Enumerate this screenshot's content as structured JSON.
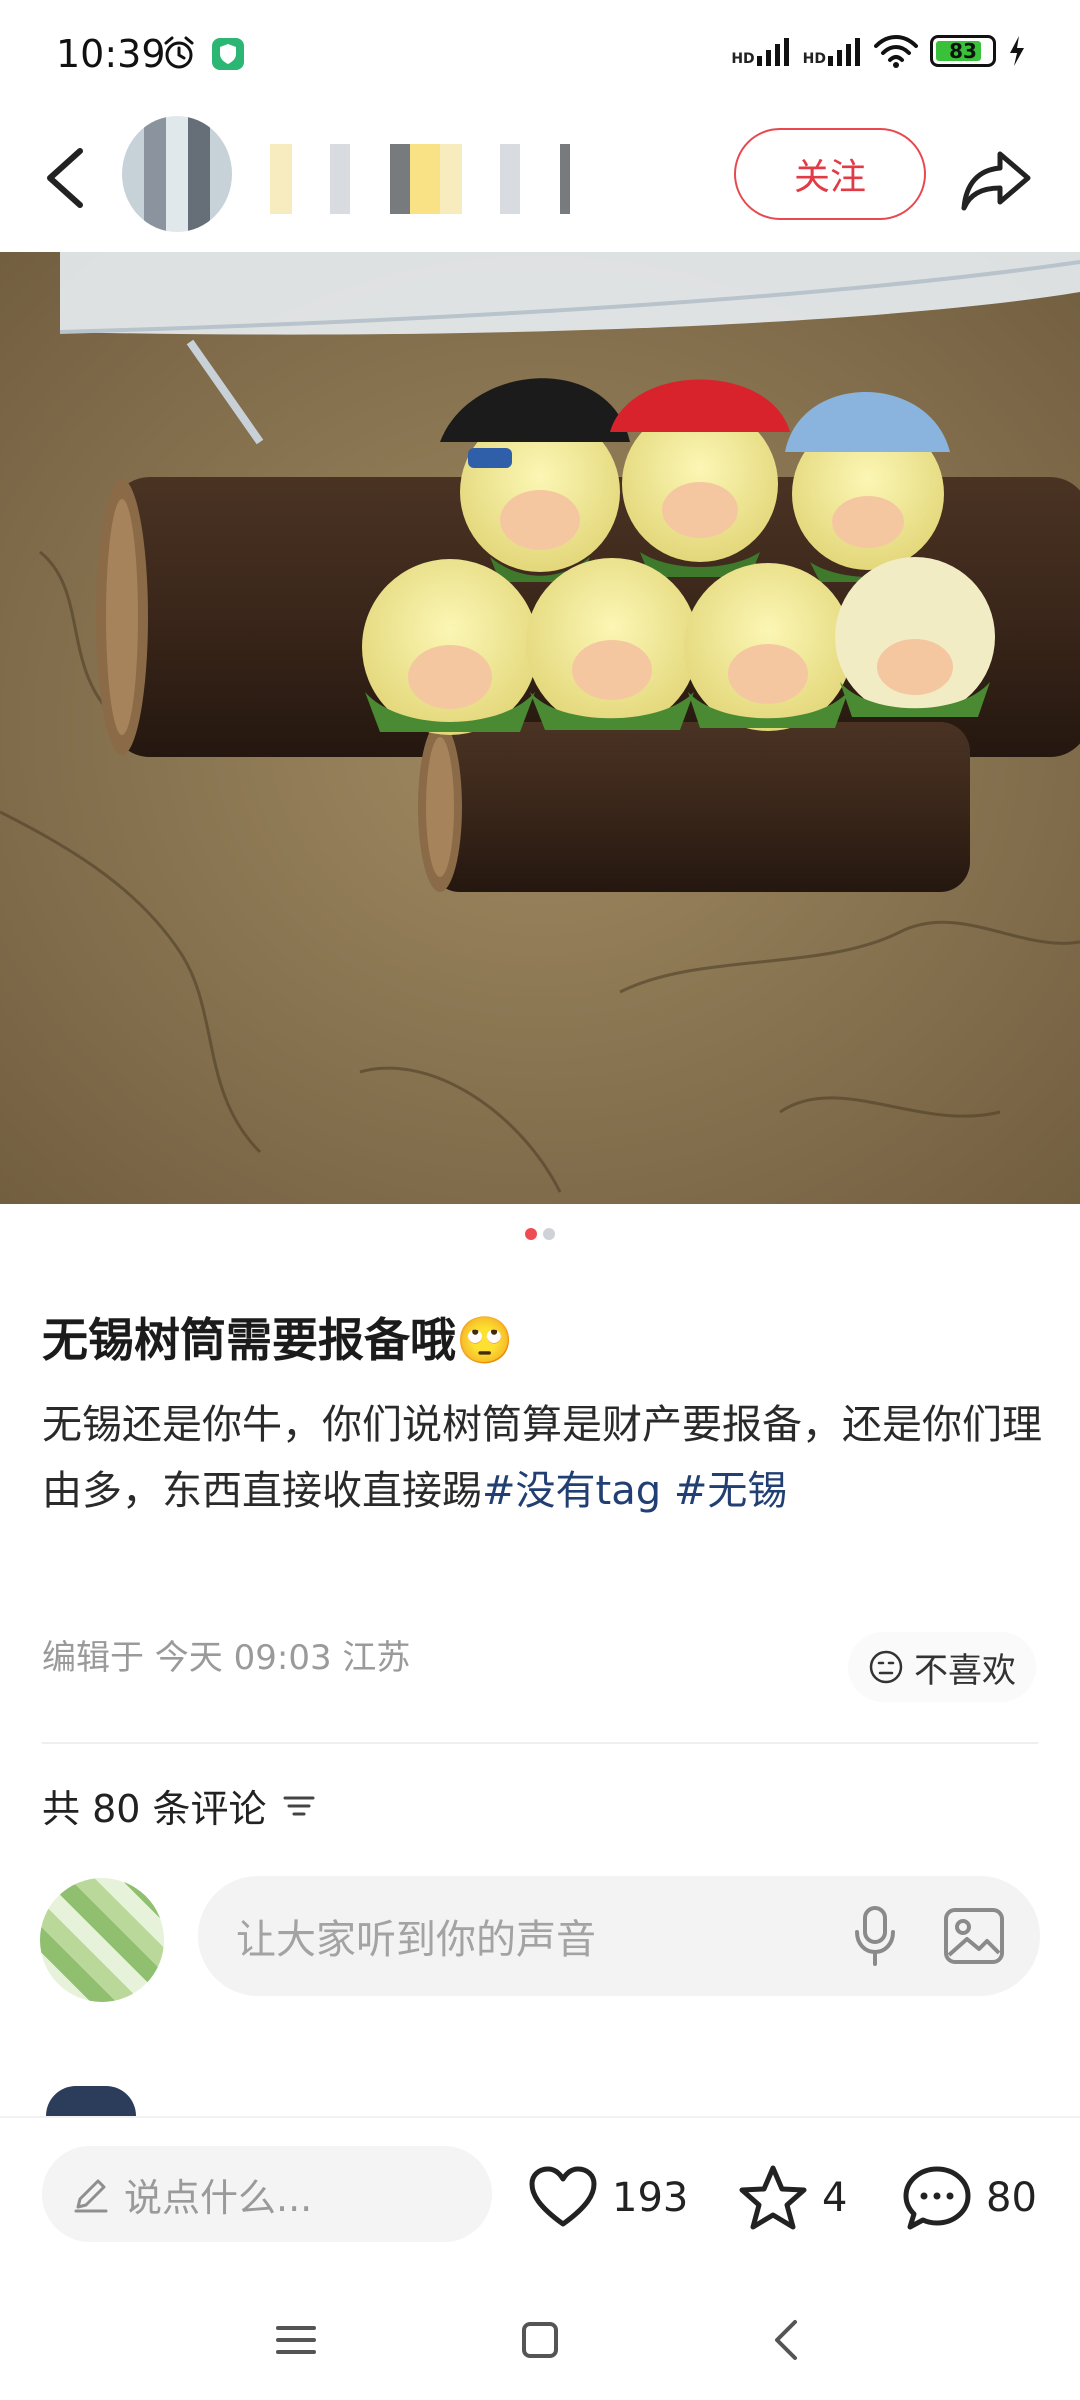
{
  "status_bar": {
    "time": "10:39",
    "signal_1": "HD",
    "signal_2": "HD",
    "battery": "83",
    "battery_level_percent": 83,
    "icons": [
      "alarm-icon",
      "shield-icon",
      "wifi-icon",
      "charging-icon"
    ]
  },
  "nav": {
    "follow_label": "关注",
    "icons": [
      "back-icon",
      "share-icon"
    ]
  },
  "image": {
    "dots_total": 2,
    "active_index": 0
  },
  "post": {
    "title": "无锡树筒需要报备哦",
    "title_emoji": "🙄",
    "body_text": "无锡还是你牛，你们说树筒算是财产要报备，还是你们理由多，东西直接收直接踢",
    "hashtag_1": "#没有tag",
    "hashtag_2": "#无锡",
    "meta": "编辑于 今天 09:03 江苏",
    "dislike_label": "不喜欢"
  },
  "comments": {
    "count_label": "共 80 条评论",
    "input_placeholder": "让大家听到你的声音"
  },
  "action_bar": {
    "say_placeholder": "说点什么...",
    "likes": "193",
    "favorites": "4",
    "comments": "80"
  },
  "colors": {
    "accent": "#e33b45",
    "hashtag": "#223f73",
    "battery_fill": "#3ac13a"
  }
}
